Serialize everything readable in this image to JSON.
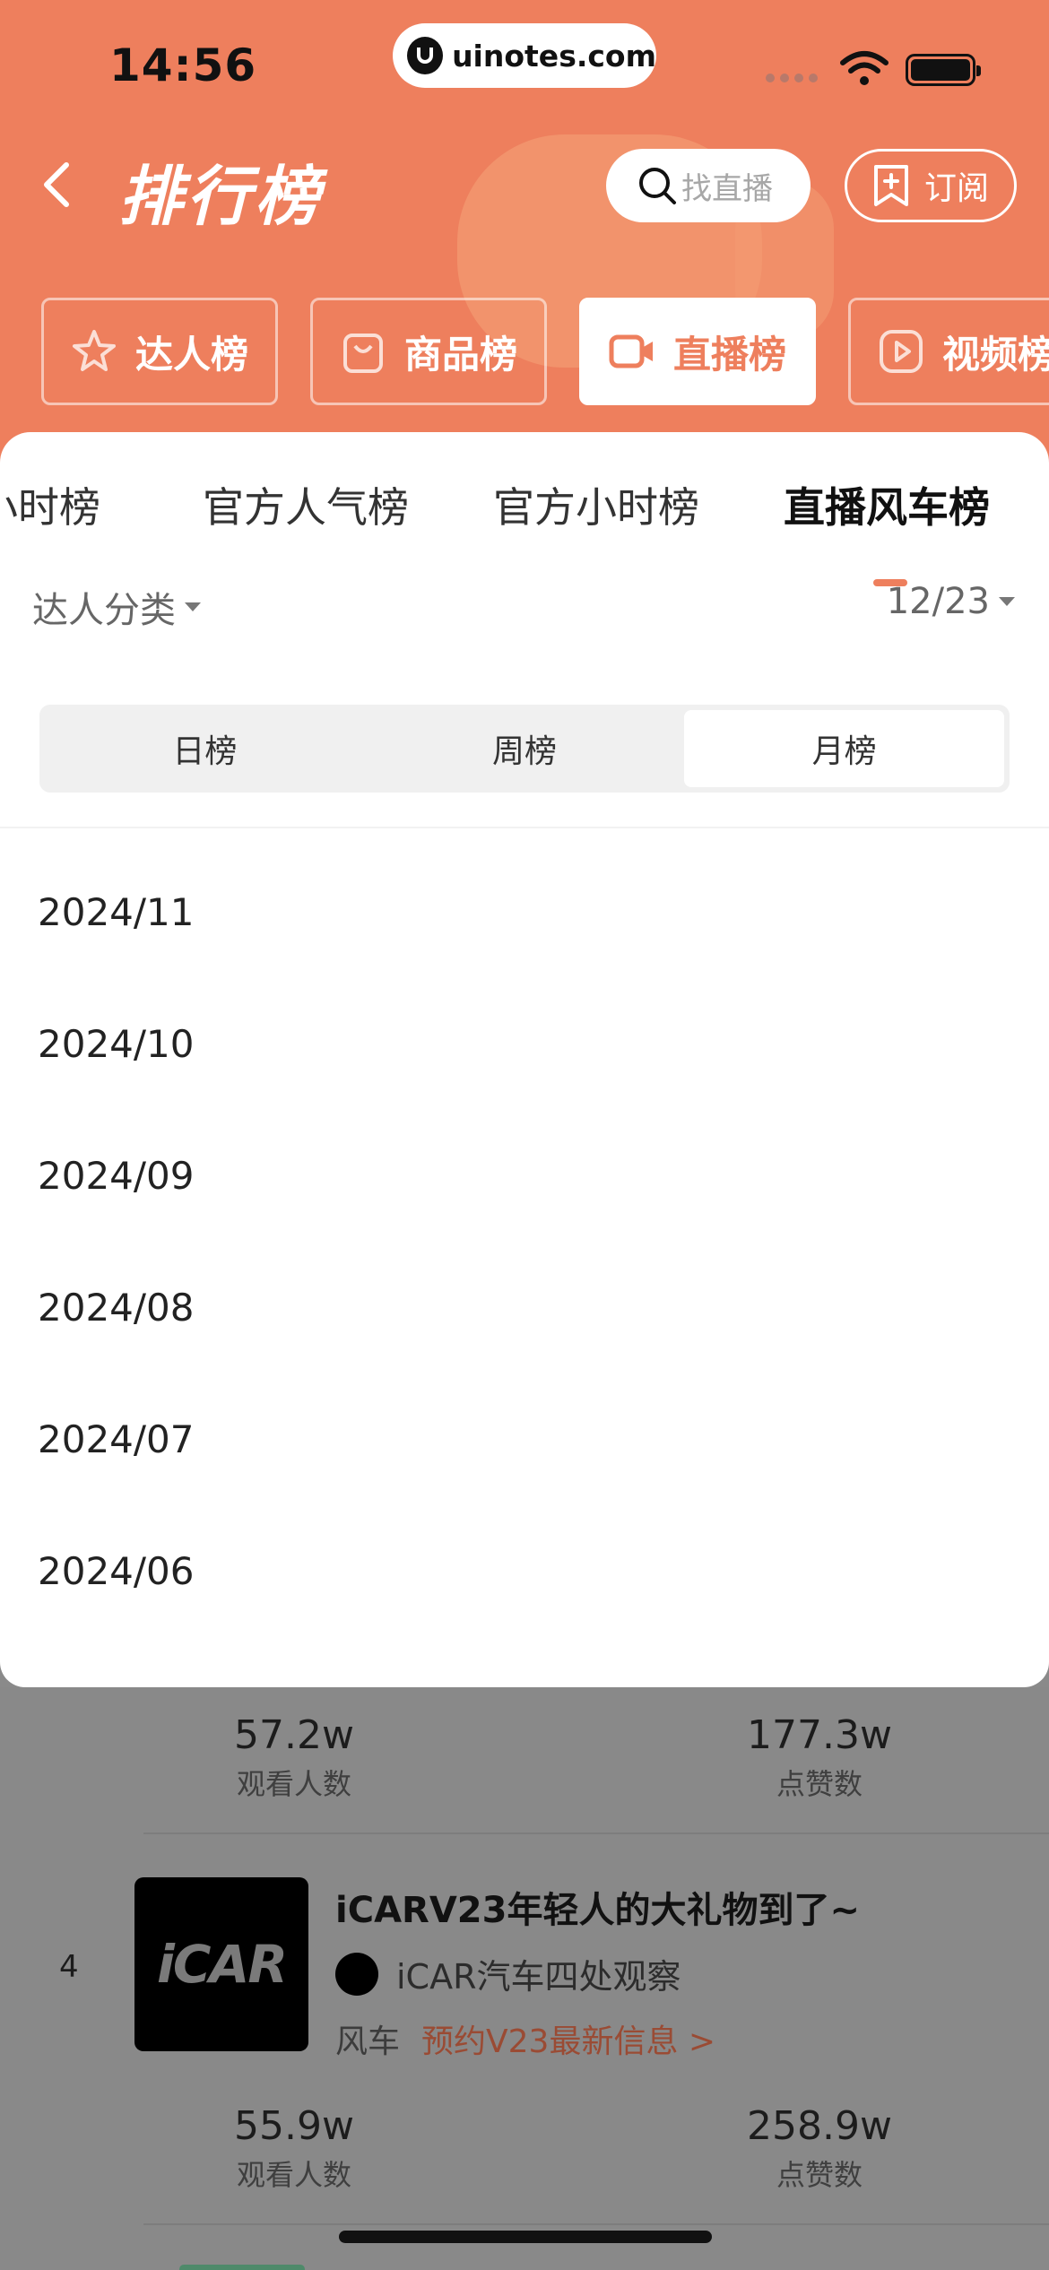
{
  "status_bar": {
    "time": "14:56",
    "site": "uinotes.com"
  },
  "header": {
    "title": "排行榜",
    "search_placeholder": "找直播",
    "subscribe_label": "订阅"
  },
  "main_tabs": [
    {
      "label": "达人榜",
      "icon": "star-icon"
    },
    {
      "label": "商品榜",
      "icon": "shopping-bag-icon"
    },
    {
      "label": "直播榜",
      "icon": "video-camera-icon",
      "active": true
    },
    {
      "label": "视频榜",
      "icon": "play-icon"
    }
  ],
  "sub_tabs": [
    {
      "label": "小时榜"
    },
    {
      "label": "官方人气榜"
    },
    {
      "label": "官方小时榜"
    },
    {
      "label": "直播风车榜",
      "active": true
    }
  ],
  "filters": {
    "category": "达人分类",
    "date": "12/23"
  },
  "period_segments": [
    {
      "label": "日榜"
    },
    {
      "label": "周榜"
    },
    {
      "label": "月榜",
      "active": true
    }
  ],
  "months": [
    "2024/11",
    "2024/10",
    "2024/09",
    "2024/08",
    "2024/07",
    "2024/06"
  ],
  "list": {
    "prev_stats": {
      "viewers": "57.2w",
      "viewers_label": "观看人数",
      "likes": "177.3w",
      "likes_label": "点赞数"
    },
    "item4": {
      "rank": "4",
      "thumb_text": "iCAR",
      "title": "iCARV23年轻人的大礼物到了~",
      "author": "iCAR汽车四处观察",
      "category": "风车",
      "link": "预约V23最新信息 >",
      "viewers": "55.9w",
      "viewers_label": "观看人数",
      "likes": "258.9w",
      "likes_label": "点赞数"
    }
  },
  "colors": {
    "accent": "#ee7f5d",
    "overlay": "#898989"
  }
}
